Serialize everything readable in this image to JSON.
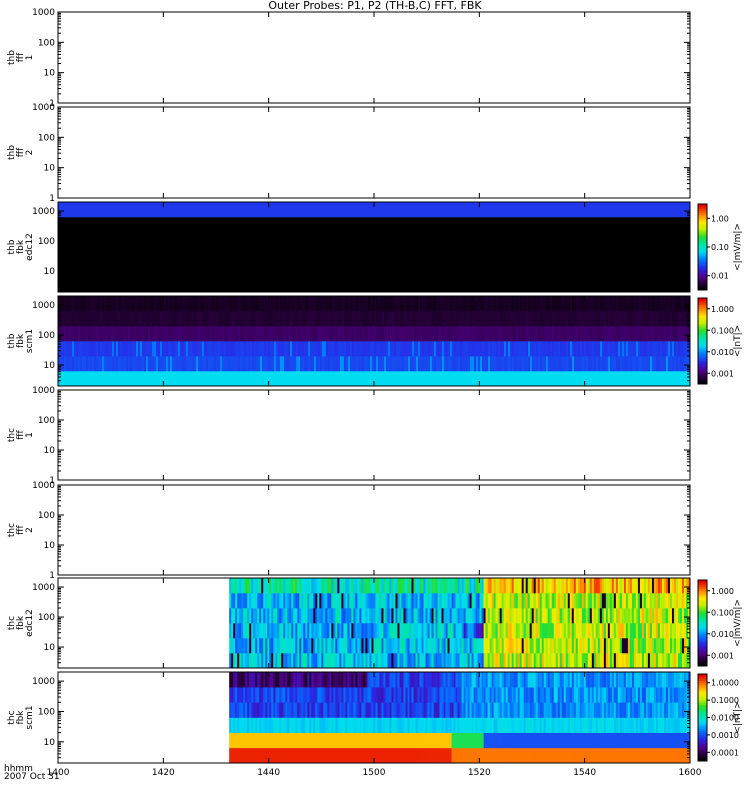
{
  "title": "Outer Probes: P1, P2 (TH-B,C) FFT, FBK",
  "footer": {
    "line1": "hhmm",
    "line2": "2007 Oct 31"
  },
  "chart_data": {
    "type": "heatmap",
    "x_ticks": [
      "1400",
      "1420",
      "1440",
      "1500",
      "1520",
      "1540",
      "1600"
    ],
    "panels": [
      {
        "ylabel": [
          "thb",
          "fff",
          "1"
        ],
        "yticks": [
          "1",
          "10",
          "100",
          "1000"
        ],
        "data": "none",
        "colorbar": null
      },
      {
        "ylabel": [
          "thb",
          "fff",
          "2"
        ],
        "yticks": [
          "1",
          "10",
          "100",
          "1000"
        ],
        "data": "none",
        "colorbar": null
      },
      {
        "ylabel": [
          "thb",
          "fbk",
          "edc12"
        ],
        "yticks": [
          "10",
          "100",
          "1000"
        ],
        "data": "thb_edc12",
        "colorbar": {
          "label": "<|mV/m|>",
          "ticks": [
            "0.01",
            "0.10",
            "1.00"
          ]
        }
      },
      {
        "ylabel": [
          "thb",
          "fbk",
          "scm1"
        ],
        "yticks": [
          "10",
          "100",
          "1000"
        ],
        "data": "thb_scm1",
        "colorbar": {
          "label": "<|nT|>",
          "ticks": [
            "0.001",
            "0.010",
            "0.100",
            "1.000"
          ]
        }
      },
      {
        "ylabel": [
          "thc",
          "fff",
          "1"
        ],
        "yticks": [
          "1",
          "10",
          "100",
          "1000"
        ],
        "data": "none",
        "colorbar": null
      },
      {
        "ylabel": [
          "thc",
          "fff",
          "2"
        ],
        "yticks": [
          "1",
          "10",
          "100",
          "1000"
        ],
        "data": "none",
        "colorbar": null
      },
      {
        "ylabel": [
          "thc",
          "fbk",
          "edc12"
        ],
        "yticks": [
          "10",
          "100",
          "1000"
        ],
        "data": "thc_edc12",
        "colorbar": {
          "label": "<|mV/m|>",
          "ticks": [
            "0.001",
            "0.010",
            "0.100",
            "1.000"
          ]
        }
      },
      {
        "ylabel": [
          "thc",
          "fbk",
          "scm1"
        ],
        "yticks": [
          "10",
          "100",
          "1000"
        ],
        "data": "thc_scm1",
        "colorbar": {
          "label": "<|nT|>",
          "ticks": [
            "0.0001",
            "0.0010",
            "0.0100",
            "0.1000",
            "1.0000"
          ]
        }
      }
    ]
  }
}
